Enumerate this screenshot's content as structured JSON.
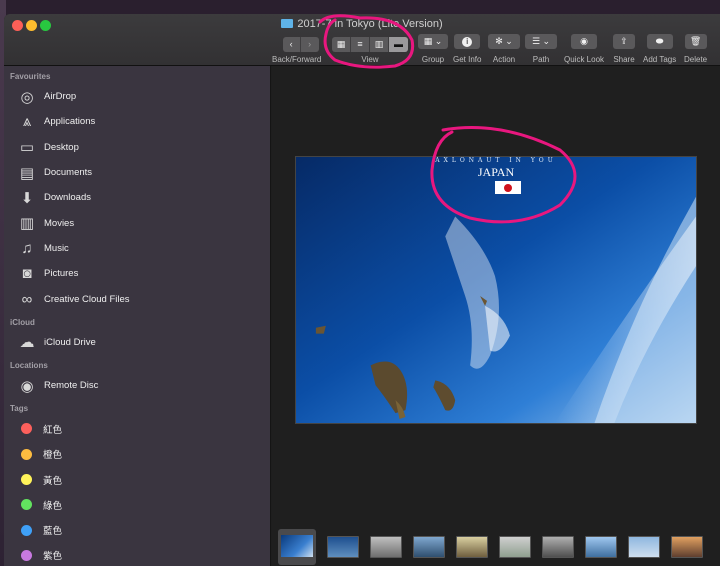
{
  "window": {
    "title": "2017-7 in Tokyo (Lite Version)"
  },
  "toolbar": {
    "back_forward": {
      "label": "Back/Forward",
      "back": "‹",
      "forward": "›"
    },
    "view": {
      "label": "View",
      "modes": [
        "icon",
        "list",
        "column",
        "gallery"
      ],
      "active": "gallery"
    },
    "group": {
      "label": "Group"
    },
    "get_info": {
      "label": "Get Info",
      "glyph": "i"
    },
    "action": {
      "label": "Action"
    },
    "path": {
      "label": "Path"
    },
    "quick_look": {
      "label": "Quick Look"
    },
    "share": {
      "label": "Share"
    },
    "add_tags": {
      "label": "Add Tags"
    },
    "delete": {
      "label": "Delete"
    }
  },
  "sidebar": {
    "favourites_title": "Favourites",
    "favourites": [
      {
        "label": "AirDrop",
        "icon": "airdrop-icon"
      },
      {
        "label": "Applications",
        "icon": "applications-icon"
      },
      {
        "label": "Desktop",
        "icon": "desktop-icon"
      },
      {
        "label": "Documents",
        "icon": "documents-icon"
      },
      {
        "label": "Downloads",
        "icon": "downloads-icon"
      },
      {
        "label": "Movies",
        "icon": "movies-icon"
      },
      {
        "label": "Music",
        "icon": "music-icon"
      },
      {
        "label": "Pictures",
        "icon": "pictures-icon"
      },
      {
        "label": "Creative Cloud Files",
        "icon": "creative-cloud-icon"
      }
    ],
    "icloud_title": "iCloud",
    "icloud": [
      {
        "label": "iCloud Drive",
        "icon": "cloud-icon"
      }
    ],
    "locations_title": "Locations",
    "locations": [
      {
        "label": "Remote Disc",
        "icon": "disc-icon"
      }
    ],
    "tags_title": "Tags",
    "tags": [
      {
        "label": "紅色",
        "color": "#fc605c"
      },
      {
        "label": "橙色",
        "color": "#fdbc40"
      },
      {
        "label": "黃色",
        "color": "#fff35a"
      },
      {
        "label": "綠色",
        "color": "#62e35f"
      },
      {
        "label": "藍色",
        "color": "#3fa0f7"
      },
      {
        "label": "紫色",
        "color": "#c879e0"
      }
    ]
  },
  "preview": {
    "caption": "AXLONAUT IN YOU",
    "headline": "JAPAN"
  },
  "annotation_color": "#e8177f"
}
